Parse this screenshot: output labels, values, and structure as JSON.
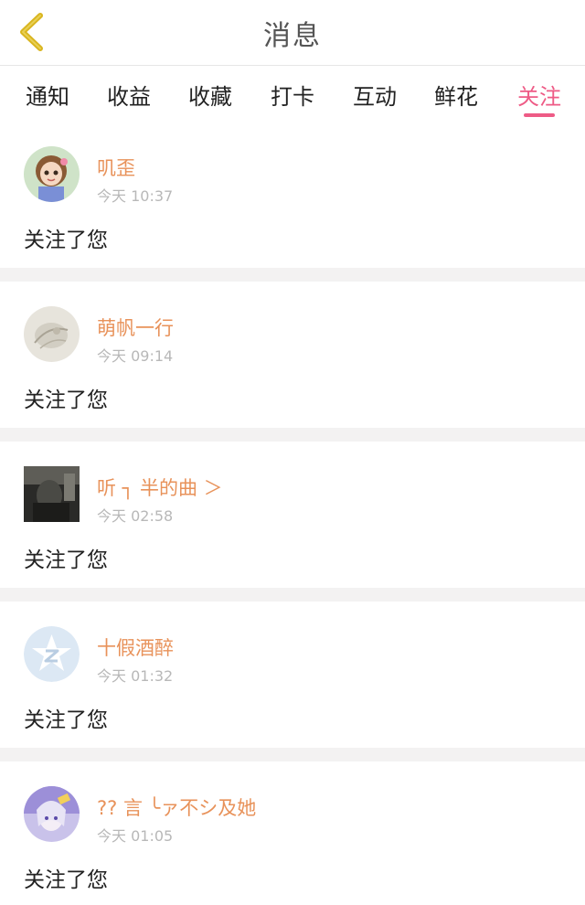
{
  "header": {
    "title": "消息",
    "back_icon": "chevron-left-icon",
    "back_color": "#d9b51f"
  },
  "tabs": [
    {
      "label": "通知"
    },
    {
      "label": "收益"
    },
    {
      "label": "收藏"
    },
    {
      "label": "打卡"
    },
    {
      "label": "互动"
    },
    {
      "label": "鲜花"
    },
    {
      "label": "关注",
      "active": true
    }
  ],
  "colors": {
    "accent": "#ee5b86",
    "name": "#e8925a",
    "time": "#b8b8b8",
    "divider": "#f3f2f2"
  },
  "items": [
    {
      "name": "叽歪",
      "time": "今天 10:37",
      "message": "关注了您",
      "avatar": "cartoon-girl-avatar"
    },
    {
      "name": "萌帆一行",
      "time": "今天 09:14",
      "message": "关注了您",
      "avatar": "sketch-avatar"
    },
    {
      "name": "听 ┐ 半的曲 ＞",
      "time": "今天 02:58",
      "message": "关注了您",
      "avatar": "dark-photo-avatar"
    },
    {
      "name": "十假酒醉",
      "time": "今天 01:32",
      "message": "关注了您",
      "avatar": "default-qzone-avatar"
    },
    {
      "name": "?? 言 ╰ァ不シ及她",
      "time": "今天 01:05",
      "message": "关注了您",
      "avatar": "anime-avatar"
    }
  ]
}
